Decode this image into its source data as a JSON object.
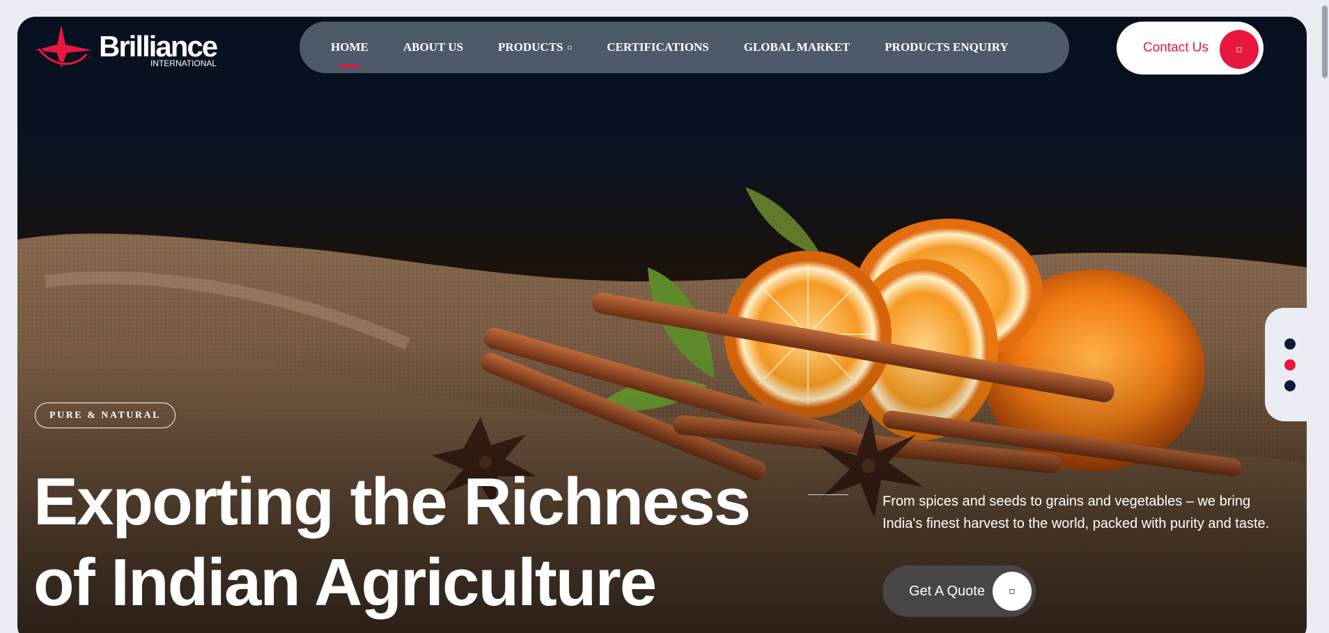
{
  "brand": {
    "name": "Brilliance",
    "sub": "INTERNATIONAL",
    "logo_icon": "red-star-swoosh-icon"
  },
  "nav": {
    "items": [
      {
        "label": "HOME",
        "active": true
      },
      {
        "label": "ABOUT US"
      },
      {
        "label": "PRODUCTS",
        "caret": "▫"
      },
      {
        "label": "CERTIFICATIONS"
      },
      {
        "label": "GLOBAL MARKET"
      },
      {
        "label": "PRODUCTS ENQUIRY"
      }
    ]
  },
  "contact": {
    "label": "Contact Us",
    "icon": "▫"
  },
  "hero": {
    "badge": "PURE & NATURAL",
    "headline_line1": "Exporting the Richness",
    "headline_line2": "of Indian Agriculture",
    "description": "From spices and seeds to grains and vegetables – we bring India's finest harvest to the world, packed with purity and taste.",
    "cta_label": "Get A Quote",
    "cta_icon": "▫",
    "image": "oranges-cinnamon-star-anise-on-burlap-photo"
  },
  "slider": {
    "count": 3,
    "active_index": 1
  },
  "colors": {
    "accent": "#e7173f",
    "navy": "#0d1b3a",
    "nav_bg": "#7b8696"
  }
}
